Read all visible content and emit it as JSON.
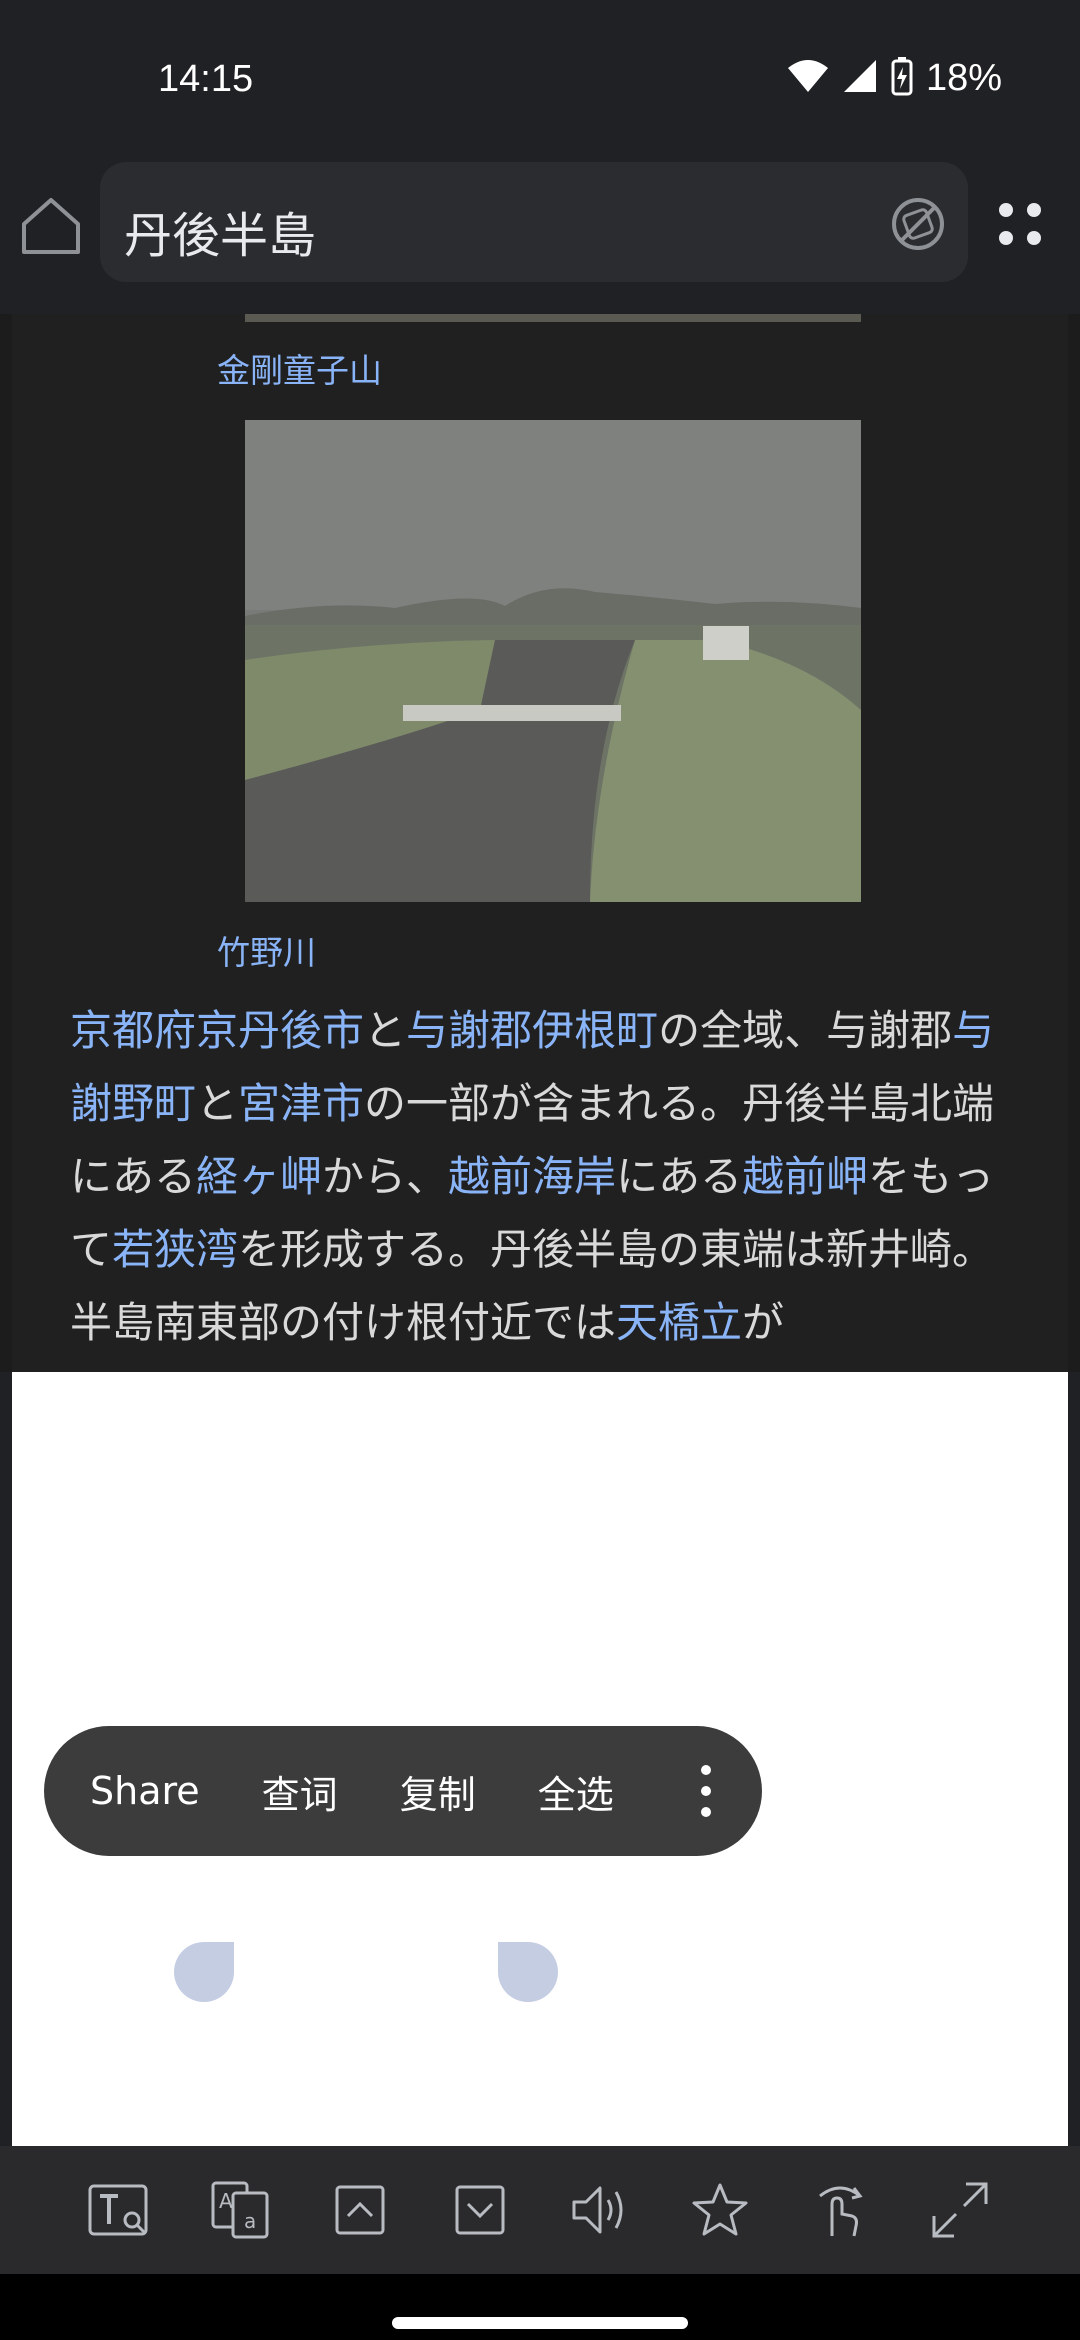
{
  "status_bar": {
    "time": "14:15",
    "battery": "18%"
  },
  "toolbar": {
    "url_text": "丹後半島"
  },
  "captions": {
    "top": "金剛童子山",
    "photo": "竹野川"
  },
  "article": {
    "segments": [
      {
        "text": "京都府",
        "link": true
      },
      {
        "text": "京丹後市",
        "link": true
      },
      {
        "text": "と",
        "link": false
      },
      {
        "text": "与謝郡",
        "link": true
      },
      {
        "text": "伊根町",
        "link": true
      },
      {
        "text": "の全域、与謝郡",
        "link": false
      },
      {
        "text": "与謝野町",
        "link": true
      },
      {
        "text": "と",
        "link": false
      },
      {
        "text": "宮津市",
        "link": true
      },
      {
        "text": "の一部が含まれる。丹後半島北端にある",
        "link": false
      },
      {
        "text": "経ヶ岬",
        "link": true
      },
      {
        "text": "から、",
        "link": false
      },
      {
        "text": "越前海岸",
        "link": true
      },
      {
        "text": "にある",
        "link": false
      },
      {
        "text": "越前岬",
        "link": true
      },
      {
        "text": "をもって",
        "link": false
      },
      {
        "text": "若狭湾",
        "link": true
      },
      {
        "text": "を形成する。丹後半島の東端は新井崎。半島南東部の付け根付近では",
        "link": false
      },
      {
        "text": "天橋立",
        "link": true
      },
      {
        "text": "が",
        "link": false
      }
    ]
  },
  "context_menu": {
    "share": "Share",
    "lookup": "查词",
    "copy": "复制",
    "select_all": "全选"
  },
  "bottom_bar": {
    "icons": [
      "text-search-icon",
      "translate-icon",
      "scroll-up-icon",
      "scroll-down-icon",
      "read-aloud-icon",
      "bookmark-star-icon",
      "gesture-icon",
      "fullscreen-icon"
    ]
  },
  "colors": {
    "link": "#8ab4f8",
    "background": "#202124",
    "overlay": "#ffffff",
    "menu": "#3c3c3d"
  }
}
